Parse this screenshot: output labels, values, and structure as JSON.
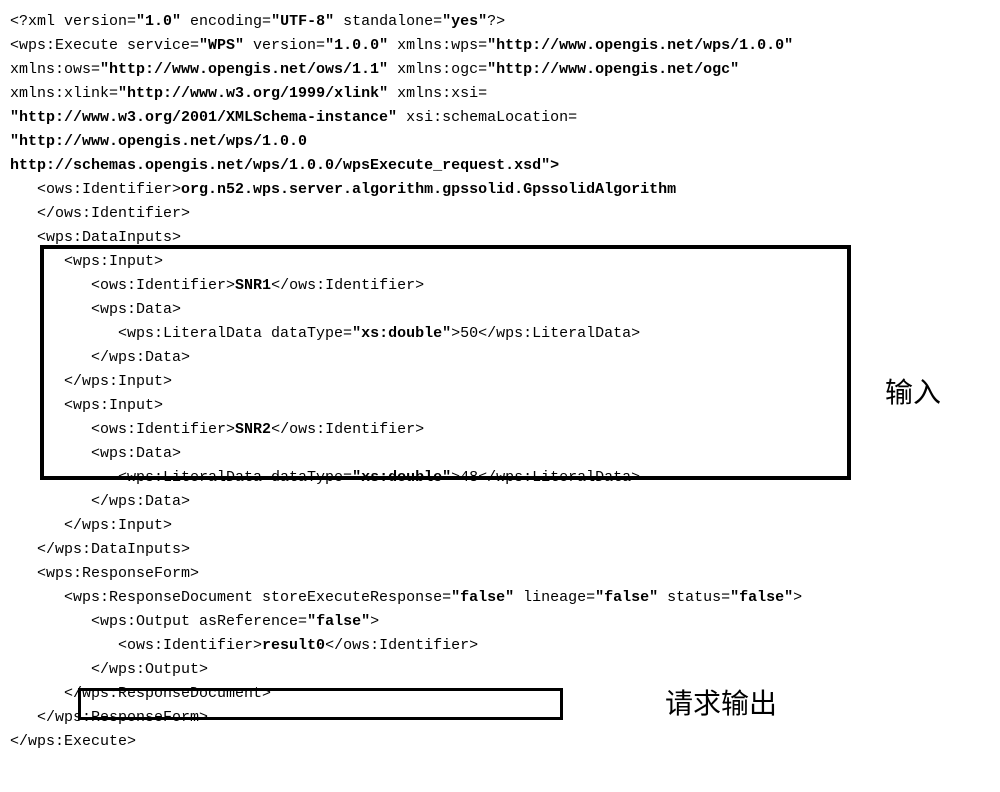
{
  "xml_decl": {
    "prefix": "<?xml version=",
    "version": "\"1.0\"",
    "enc_label": " encoding=",
    "encoding": "\"UTF-8\"",
    "stand_label": " standalone=",
    "standalone": "\"yes\"",
    "suffix": "?>"
  },
  "execute_open": {
    "p1": "<wps:Execute service=",
    "v1": "\"WPS\"",
    "p2": " version=",
    "v2": "\"1.0.0\"",
    "p3": " xmlns:wps=",
    "v3": "\"http://www.opengis.net/wps/1.0.0\"",
    "p4": "xmlns:ows=",
    "v4": "\"http://www.opengis.net/ows/1.1\"",
    "p5": " xmlns:ogc=",
    "v5": "\"http://www.opengis.net/ogc\"",
    "p6": "xmlns:xlink=",
    "v6": "\"http://www.w3.org/1999/xlink\"",
    "p7": " xmlns:xsi=",
    "v7": "\"http://www.w3.org/2001/XMLSchema-instance\"",
    "p8": " xsi:schemaLocation=",
    "v8a": "\"http://www.opengis.net/wps/1.0.0",
    "v8b": "http://schemas.opengis.net/wps/1.0.0/wpsExecute_request.xsd\">"
  },
  "identifier": {
    "open": "   <ows:Identifier>",
    "value": "org.n52.wps.server.algorithm.gpssolid.GpssolidAlgorithm",
    "close": "   </ows:Identifier>"
  },
  "data_inputs_open": "   <wps:DataInputs>",
  "input1": {
    "open": "      <wps:Input>",
    "id_open": "         <ows:Identifier>",
    "id_val": "SNR1",
    "id_close": "</ows:Identifier>",
    "data_open": "         <wps:Data>",
    "lit_open": "            <wps:LiteralData dataType=",
    "lit_type": "\"xs:double\"",
    "lit_mid": ">",
    "lit_val": "50",
    "lit_close": "</wps:LiteralData>",
    "data_close": "         </wps:Data>",
    "close": "      </wps:Input>"
  },
  "input2": {
    "open": "      <wps:Input>",
    "id_open": "         <ows:Identifier>",
    "id_val": "SNR2",
    "id_close": "</ows:Identifier>",
    "data_open": "         <wps:Data>",
    "lit_open": "            <wps:LiteralData dataType=",
    "lit_type": "\"xs:double\"",
    "lit_mid": ">",
    "lit_val": "48",
    "lit_close": "</wps:LiteralData>",
    "data_close": "         </wps:Data>",
    "close": "      </wps:Input>"
  },
  "data_inputs_close": "   </wps:DataInputs>",
  "response_form_open": "   <wps:ResponseForm>",
  "response_doc": {
    "p1": "      <wps:ResponseDocument storeExecuteResponse=",
    "v1": "\"false\"",
    "p2": " lineage=",
    "v2": "\"false\"",
    "p3": " status=",
    "v3": "\"false\"",
    "p4": ">"
  },
  "output": {
    "p1": "         <wps:Output asReference=",
    "v1": "\"false\"",
    "p2": ">",
    "id_open": "            <ows:Identifier>",
    "id_val": "result0",
    "id_close": "</ows:Identifier>",
    "close": "         </wps:Output>"
  },
  "response_doc_close": "      </wps:ResponseDocument>",
  "response_form_close": "   </wps:ResponseForm>",
  "execute_close": "</wps:Execute>",
  "labels": {
    "input": "输入",
    "output": "请求输出"
  }
}
